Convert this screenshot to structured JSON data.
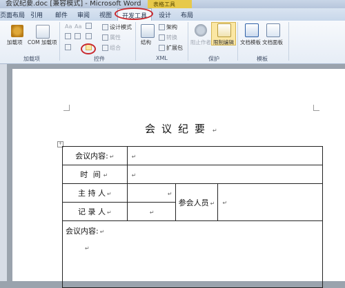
{
  "window": {
    "title": "会议纪要.doc [兼容模式] - Microsoft Word",
    "context_tab_header": "表格工具"
  },
  "tabs": [
    {
      "label": "页面布局"
    },
    {
      "label": "引用"
    },
    {
      "label": "邮件"
    },
    {
      "label": "审阅"
    },
    {
      "label": "视图"
    },
    {
      "label": "开发工具"
    },
    {
      "label": "设计"
    },
    {
      "label": "布局"
    }
  ],
  "ribbon": {
    "addins": {
      "label": "加载项",
      "addin_button": "加载项",
      "com_addin_button": "COM 加载项"
    },
    "controls": {
      "label": "控件",
      "design_mode": "设计模式",
      "properties": "属性",
      "group": "组合"
    },
    "xml": {
      "label": "XML",
      "structure": "结构",
      "schema": "架构",
      "transform": "转换",
      "expansion_pack": "扩展包"
    },
    "protect": {
      "label": "保护",
      "block_authors": "阻止作者",
      "restrict_editing": "限制编辑"
    },
    "templates": {
      "label": "模板",
      "document_template": "文档模板",
      "document_panel": "文档面板"
    }
  },
  "document": {
    "title": "会议纪要",
    "para_mark": "↵",
    "table": {
      "topic_label": "会议内容:",
      "time_label": "时 间",
      "host_label": "主 持 人",
      "recorder_label": "记 录 人",
      "attendees_label": "参会人员",
      "content_label": "会议内容:"
    }
  },
  "colors": {
    "highlight_ellipse": "#c9282d",
    "context_tab": "#e7c94a"
  }
}
